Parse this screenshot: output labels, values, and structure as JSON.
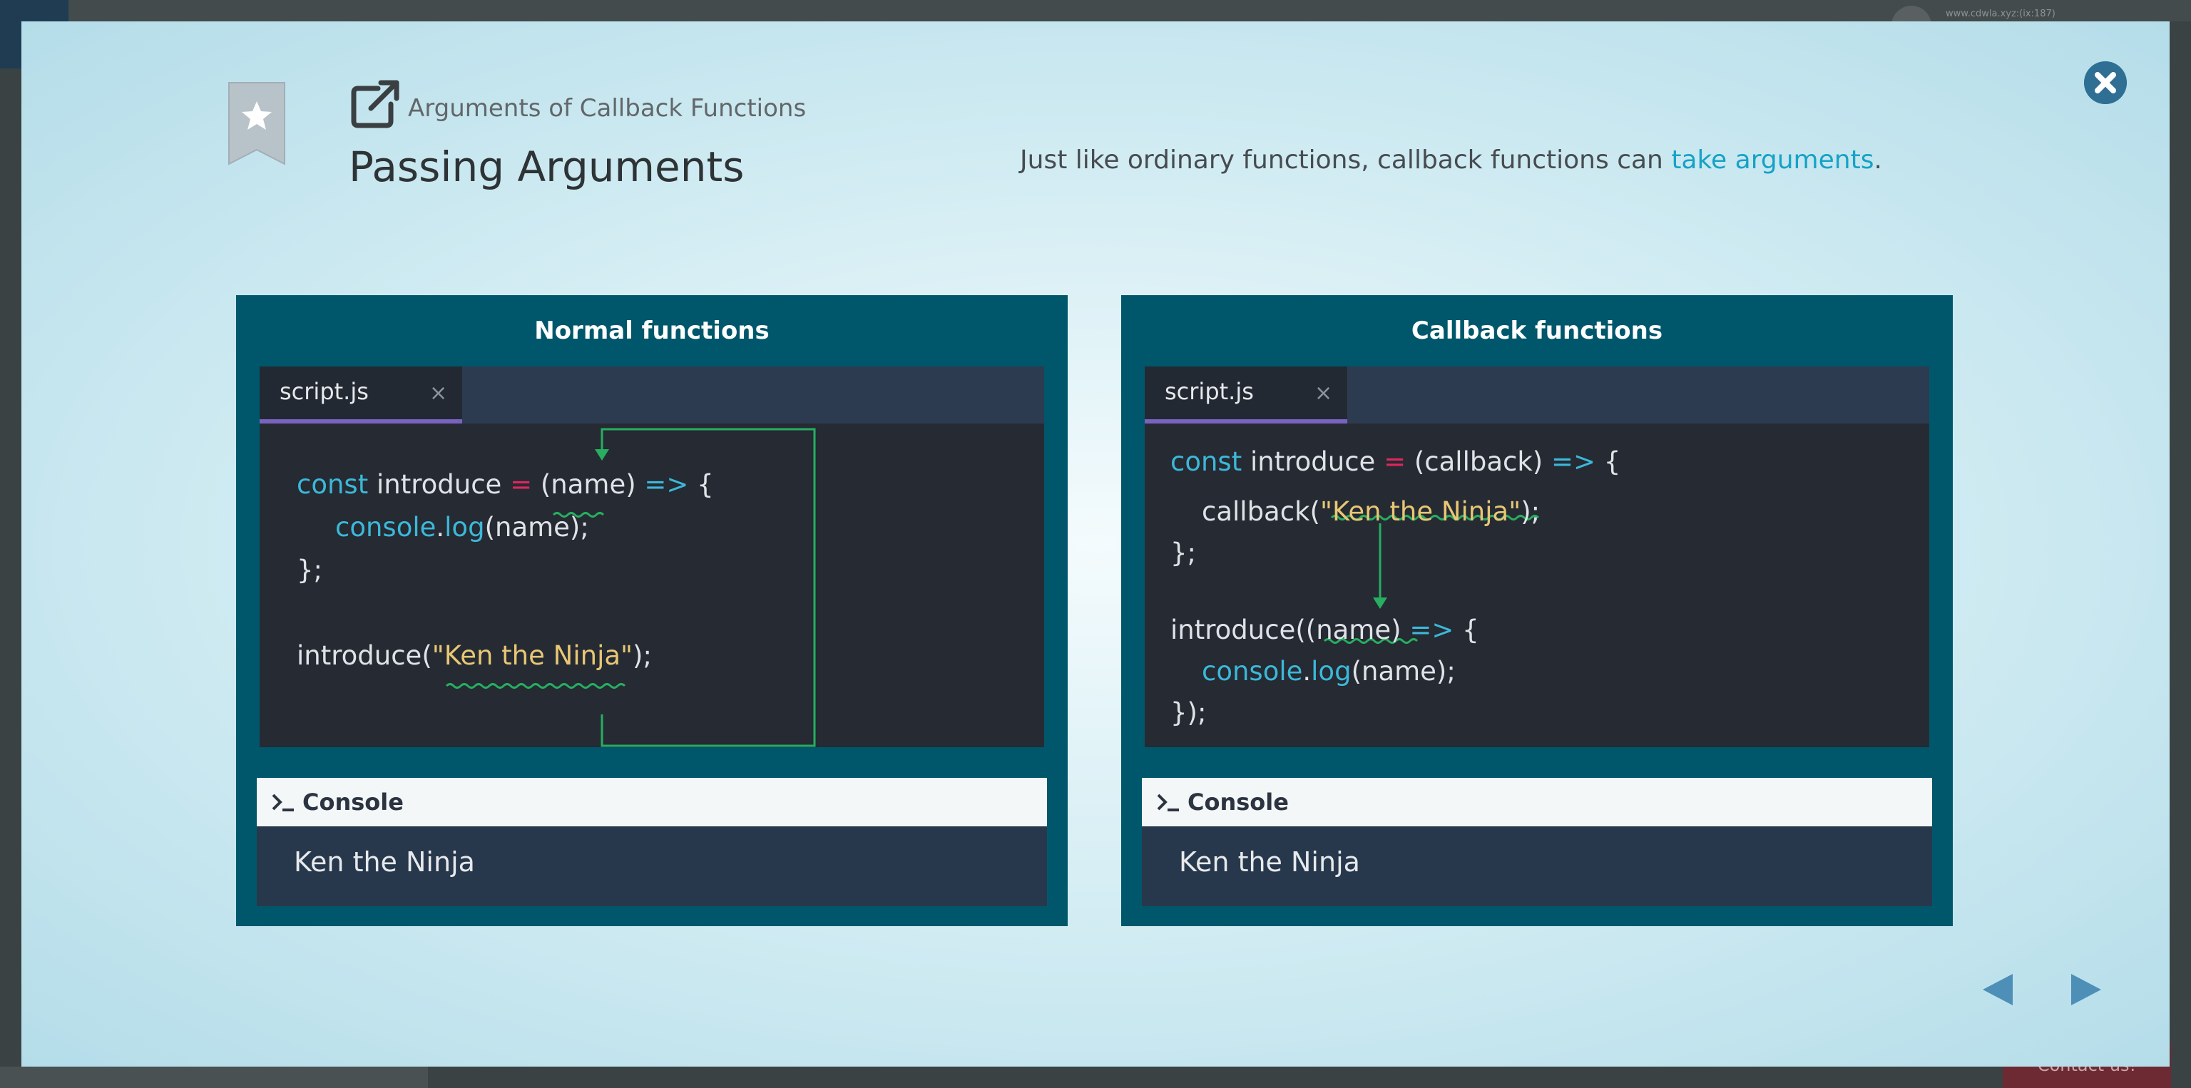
{
  "background": {
    "url_text": "www.cdwla.xyz:(ix:187)",
    "contact_label": "Contact us!"
  },
  "modal": {
    "subtitle": "Arguments of Callback Functions",
    "title": "Passing Arguments",
    "description": {
      "before": "Just like ordinary functions, callback functions can ",
      "link": "take arguments",
      "after": "."
    },
    "icons": {
      "bookmark": "bookmark-star-icon",
      "external": "external-link-icon",
      "close": "close-icon",
      "prev": "arrow-left-icon",
      "next": "arrow-right-icon"
    },
    "colors": {
      "panel": "#00576b",
      "editor": "#252a33",
      "keyword": "#3cb8d8",
      "operator": "#e0265d",
      "string": "#e8c774",
      "arrow": "#27ae60",
      "link": "#16a2c7"
    }
  },
  "panels": [
    {
      "title": "Normal functions",
      "tab_label": "script.js",
      "tab_close": "×",
      "code": {
        "l1": {
          "kw": "const",
          "sp1": " introduce ",
          "op": "=",
          "sp2": " (",
          "arg": "name",
          "close": ")",
          "arrow": " =>",
          "brace": " {"
        },
        "l2": {
          "obj": "console",
          "dot": ".",
          "fn": "log",
          "rest": "(name);"
        },
        "l3": "};",
        "l4": {
          "call": "introduce(",
          "str": "\"Ken the Ninja\"",
          "end": ");"
        }
      },
      "console_label": "Console",
      "console_output": "Ken the Ninja"
    },
    {
      "title": "Callback functions",
      "tab_label": "script.js",
      "tab_close": "×",
      "code": {
        "l1": {
          "kw": "const",
          "sp1": " introduce ",
          "op": "=",
          "sp2": " (callback)",
          "arrow": " =>",
          "brace": " {"
        },
        "l2": {
          "call": "callback(",
          "str": "\"Ken the Ninja\"",
          "end": ");"
        },
        "l3": "};",
        "l4": {
          "call": "introduce((",
          "arg": "name",
          "close": ")",
          "arrow": " =>",
          "brace": " {"
        },
        "l5": {
          "obj": "console",
          "dot": ".",
          "fn": "log",
          "rest": "(name);"
        },
        "l6": "});"
      },
      "console_label": "Console",
      "console_output": "Ken the Ninja"
    }
  ]
}
